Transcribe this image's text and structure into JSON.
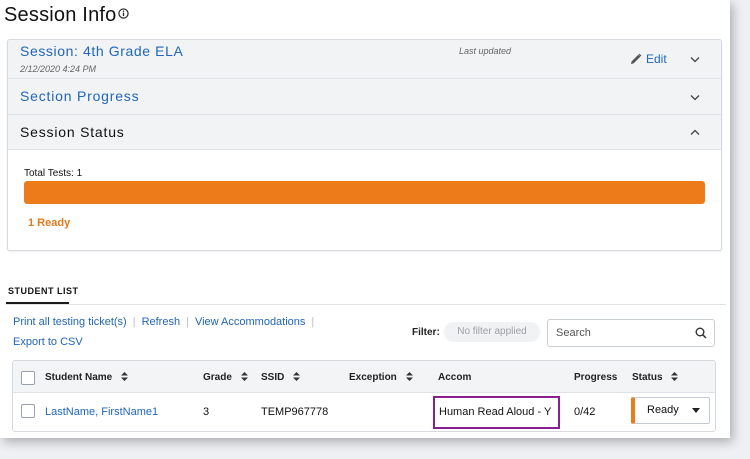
{
  "page": {
    "title": "Session Info"
  },
  "session": {
    "title": "Session: 4th Grade ELA",
    "date": "2/12/2020 4:24 PM",
    "last_updated": "Last updated",
    "edit_label": "Edit"
  },
  "section_progress": {
    "label": "Section Progress"
  },
  "session_status": {
    "label": "Session Status",
    "total_tests": "Total Tests: 1",
    "progress_fraction": 1.0,
    "ready_label": "1 Ready"
  },
  "student_list": {
    "tab": "STUDENT LIST",
    "actions": {
      "print": "Print all testing ticket(s)",
      "refresh": "Refresh",
      "view_accommodations": "View Accommodations",
      "export": "Export to CSV"
    },
    "filter": {
      "label": "Filter:",
      "value": "No filter applied"
    },
    "search": {
      "placeholder": "Search"
    },
    "columns": {
      "student_name": "Student Name",
      "grade": "Grade",
      "ssid": "SSID",
      "exception": "Exception",
      "accom": "Accom",
      "progress": "Progress",
      "status": "Status"
    },
    "rows": [
      {
        "student_name": "LastName, FirstName1",
        "grade": "3",
        "ssid": "TEMP967778",
        "exception": "",
        "accom": "Human Read Aloud - Y",
        "progress": "0/42",
        "status": "Ready"
      }
    ]
  },
  "colors": {
    "accent_blue": "#2166b8",
    "status_orange": "#ee7b1a",
    "highlight_purple": "#8a1f8f"
  },
  "icons": [
    "info-icon",
    "pencil-icon",
    "chevron-down-icon",
    "chevron-up-icon",
    "sort-icon",
    "search-icon",
    "caret-down-icon"
  ]
}
